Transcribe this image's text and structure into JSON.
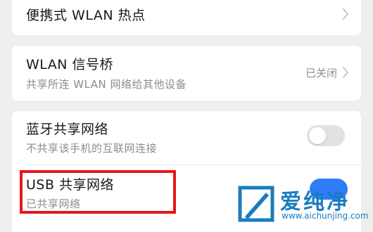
{
  "settings": {
    "hotspot": {
      "title": "便携式 WLAN 热点"
    },
    "wlan_bridge": {
      "title": "WLAN 信号桥",
      "subtitle": "共享所连 WLAN 网络给其他设备",
      "status": "已关闭"
    },
    "bluetooth_tethering": {
      "title": "蓝牙共享网络",
      "subtitle": "不共享该手机的互联网连接",
      "enabled": false
    },
    "usb_tethering": {
      "title": "USB 共享网络",
      "subtitle": "已共享网络",
      "enabled": true
    }
  },
  "watermark": {
    "name": "爱纯净",
    "url": "www.aichunjing.com"
  },
  "colors": {
    "background": "#efefef",
    "card": "#ffffff",
    "highlight": "#e8151b",
    "toggle_on": "#2f7df6",
    "toggle_off": "#e2e2e2",
    "watermark": "#1a7cc0"
  }
}
